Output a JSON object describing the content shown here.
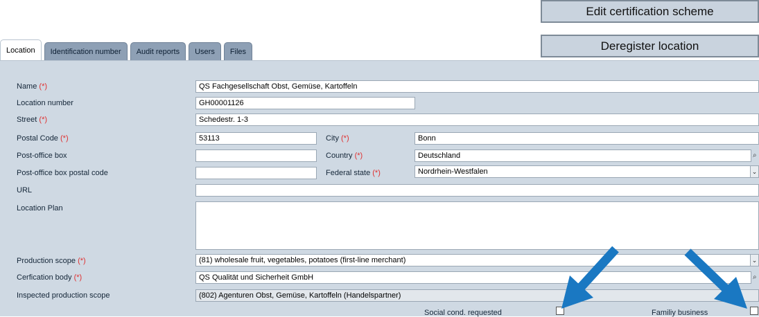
{
  "actions": {
    "edit_scheme": "Edit certification scheme",
    "deregister": "Deregister location"
  },
  "tabs": [
    "Location",
    "Identification number",
    "Audit reports",
    "Users",
    "Files"
  ],
  "required_marker": "(*)",
  "fields": {
    "name": {
      "label": "Name",
      "value": "QS Fachgesellschaft Obst, Gemüse, Kartoffeln"
    },
    "location_number": {
      "label": "Location number",
      "value": "GH00001126"
    },
    "street": {
      "label": "Street",
      "value": "Schedestr. 1-3"
    },
    "postal_code": {
      "label": "Postal Code",
      "value": "53113"
    },
    "city": {
      "label": "City",
      "value": "Bonn"
    },
    "po_box": {
      "label": "Post-office box",
      "value": ""
    },
    "country": {
      "label": "Country",
      "value": "Deutschland"
    },
    "po_box_postal_code": {
      "label": "Post-office box postal code",
      "value": ""
    },
    "federal_state": {
      "label": "Federal state",
      "value": "Nordrhein-Westfalen"
    },
    "url": {
      "label": "URL",
      "value": ""
    },
    "location_plan": {
      "label": "Location Plan",
      "value": ""
    },
    "production_scope": {
      "label": "Production scope",
      "value": "(81) wholesale fruit, vegetables, potatoes (first-line merchant)"
    },
    "certification_body": {
      "label": "Cerfication body",
      "value": "QS Qualität und Sicherheit GmbH"
    },
    "inspected_scope": {
      "label": "Inspected production scope",
      "value": "(802) Agenturen Obst, Gemüse, Kartoffeln (Handelspartner)"
    },
    "social_cond": {
      "label": "Social cond. requested",
      "checked": false
    },
    "family_business": {
      "label": "Familiy business",
      "checked": false
    }
  },
  "colors": {
    "annotation_arrow": "#1a78c2",
    "required": "#e03030"
  }
}
